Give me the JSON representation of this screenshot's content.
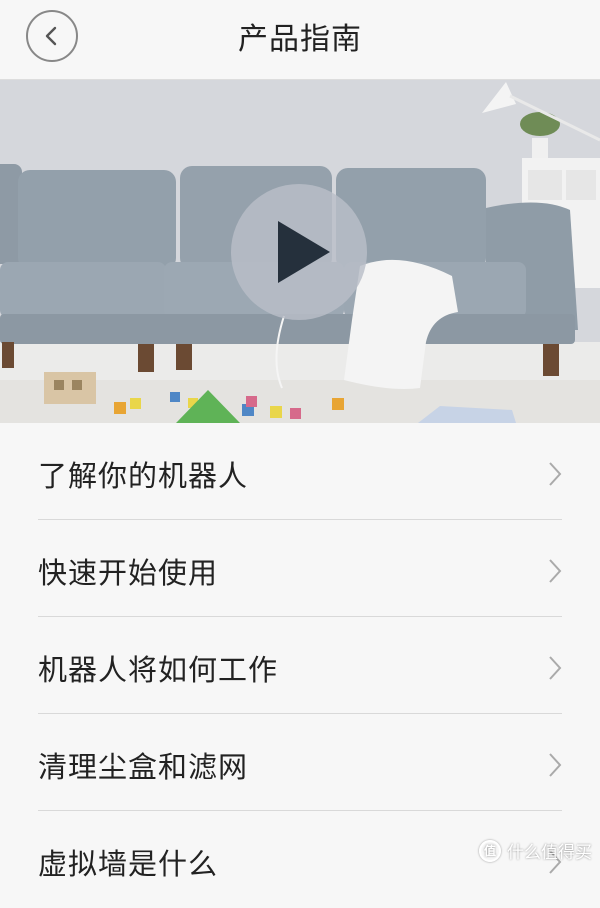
{
  "header": {
    "title": "产品指南",
    "back_icon": "chevron-left-icon"
  },
  "video": {
    "play_icon": "play-icon"
  },
  "menu": {
    "items": [
      {
        "label": "了解你的机器人",
        "icon": "chevron-right-icon"
      },
      {
        "label": "快速开始使用",
        "icon": "chevron-right-icon"
      },
      {
        "label": "机器人将如何工作",
        "icon": "chevron-right-icon"
      },
      {
        "label": "清理尘盒和滤网",
        "icon": "chevron-right-icon"
      },
      {
        "label": "虚拟墙是什么",
        "icon": "chevron-right-icon"
      }
    ]
  },
  "watermark": {
    "badge": "值",
    "text": "什么值得买"
  }
}
